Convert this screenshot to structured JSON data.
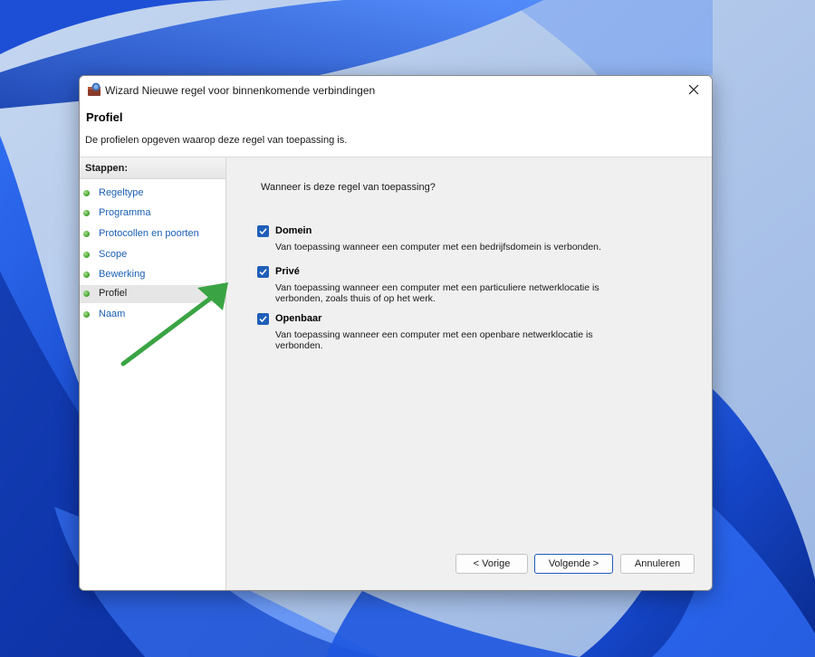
{
  "window": {
    "title": "Wizard Nieuwe regel voor binnenkomende verbindingen",
    "close_icon": "close-icon",
    "app_icon": "firewall-icon"
  },
  "header": {
    "title": "Profiel",
    "description": "De profielen opgeven waarop deze regel van toepassing is."
  },
  "sidebar": {
    "header": "Stappen:",
    "active_step": "Profiel",
    "items": [
      {
        "label": "Regeltype"
      },
      {
        "label": "Programma"
      },
      {
        "label": "Protocollen en poorten"
      },
      {
        "label": "Scope"
      },
      {
        "label": "Bewerking"
      },
      {
        "label": "Profiel"
      },
      {
        "label": "Naam"
      }
    ]
  },
  "main": {
    "question": "Wanneer is deze regel van toepassing?",
    "options": [
      {
        "label": "Domein",
        "checked": true,
        "description": "Van toepassing wanneer een computer met een bedrijfsdomein is verbonden."
      },
      {
        "label": "Privé",
        "checked": true,
        "description": "Van toepassing wanneer een computer met een particuliere netwerklocatie is verbonden, zoals thuis of op het werk."
      },
      {
        "label": "Openbaar",
        "checked": true,
        "description": "Van toepassing wanneer een computer met een openbare netwerklocatie is verbonden."
      }
    ]
  },
  "buttons": {
    "back": "< Vorige",
    "next": "Volgende >",
    "cancel": "Annuleren"
  },
  "colors": {
    "accent": "#1f5fb8",
    "link": "#1a5fb4",
    "annotation_arrow": "#3aa444"
  }
}
